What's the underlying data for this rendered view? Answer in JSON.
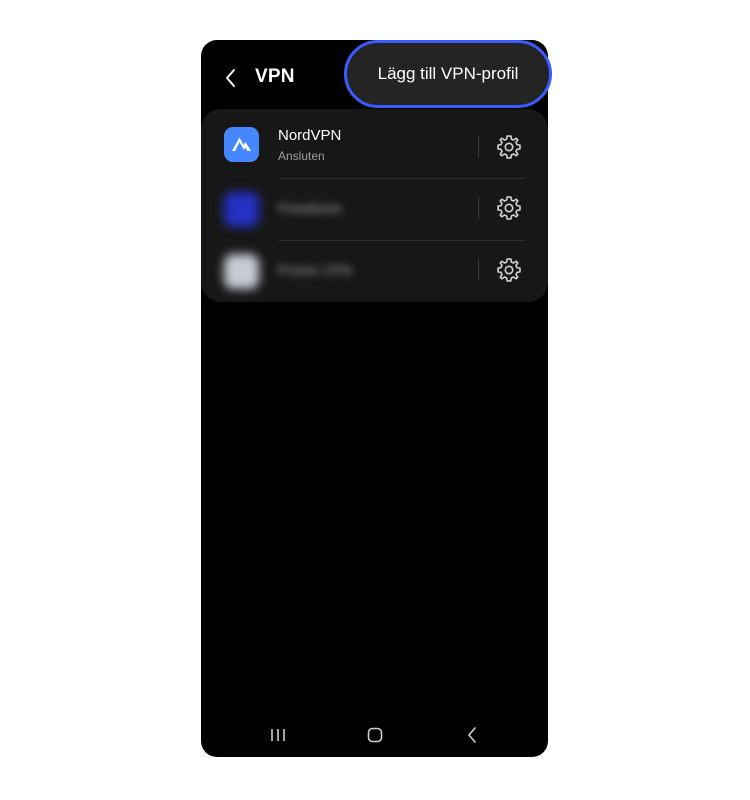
{
  "header": {
    "title": "VPN",
    "back_icon": "chevron-left-icon"
  },
  "vpn_list": [
    {
      "name": "NordVPN",
      "status": "Ansluten",
      "icon": "nordvpn-logo-icon",
      "icon_color": "#4687ff",
      "blurred": false
    },
    {
      "name": "Freedome",
      "icon": "app-icon",
      "icon_color": "#2431c4",
      "blurred": true
    },
    {
      "name": "Proton VPN",
      "icon": "app-icon",
      "icon_color": "#c9ccd6",
      "blurred": true
    }
  ],
  "add_profile": {
    "label": "Lägg till VPN-profil",
    "highlight_color": "#3b5bff"
  },
  "navbar": {
    "recents_icon": "recents-icon",
    "home_icon": "home-icon",
    "back_icon": "back-icon"
  },
  "colors": {
    "background": "#000000",
    "card": "#171717",
    "text": "#ffffff",
    "subtext": "#9e9e9e"
  }
}
